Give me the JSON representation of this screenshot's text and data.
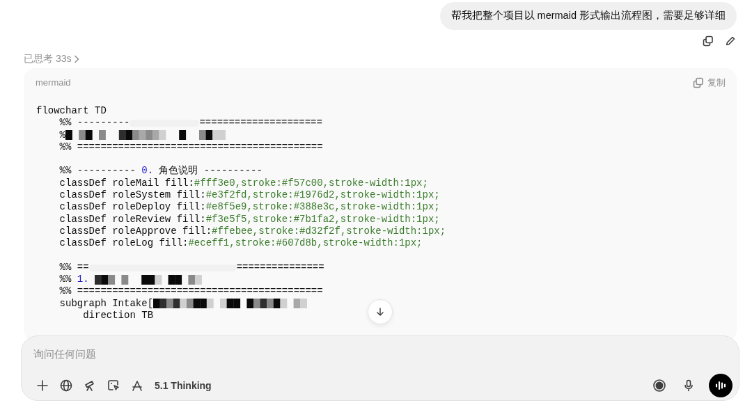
{
  "user_message": {
    "text": "帮我把整个项目以 mermaid 形式输出流程图，需要足够详细"
  },
  "thinking": {
    "label": "已思考 33s"
  },
  "code_block": {
    "language": "mermaid",
    "copy_label": "复制",
    "lines": [
      {
        "segments": [
          {
            "kind": "plain",
            "text": "flowchart TD"
          }
        ]
      },
      {
        "segments": [
          {
            "kind": "plain",
            "text": "    %% ---------"
          },
          {
            "kind": "smear"
          },
          {
            "kind": "plain",
            "text": "====================="
          }
        ]
      },
      {
        "segments": [
          {
            "kind": "plain",
            "text": "    %"
          },
          {
            "kind": "mosaic"
          }
        ]
      },
      {
        "segments": [
          {
            "kind": "plain",
            "text": "    %% =========================================="
          }
        ]
      },
      {
        "blank": true
      },
      {
        "segments": [
          {
            "kind": "plain",
            "text": "    %% ---------- "
          },
          {
            "kind": "number",
            "text": "0."
          },
          {
            "kind": "plain",
            "text": " 角色说明 ----------"
          }
        ]
      },
      {
        "segments": [
          {
            "kind": "plain",
            "text": "    classDef roleMail fill:"
          },
          {
            "kind": "value",
            "text": "#fff3e0,stroke:#f57c00,stroke-width:1px;"
          }
        ]
      },
      {
        "segments": [
          {
            "kind": "plain",
            "text": "    classDef roleSystem fill:"
          },
          {
            "kind": "value",
            "text": "#e3f2fd,stroke:#1976d2,stroke-width:1px;"
          }
        ]
      },
      {
        "segments": [
          {
            "kind": "plain",
            "text": "    classDef roleDeploy fill:"
          },
          {
            "kind": "value",
            "text": "#e8f5e9,stroke:#388e3c,stroke-width:1px;"
          }
        ]
      },
      {
        "segments": [
          {
            "kind": "plain",
            "text": "    classDef roleReview fill:"
          },
          {
            "kind": "value",
            "text": "#f3e5f5,stroke:#7b1fa2,stroke-width:1px;"
          }
        ]
      },
      {
        "segments": [
          {
            "kind": "plain",
            "text": "    classDef roleApprove fill:"
          },
          {
            "kind": "value",
            "text": "#ffebee,stroke:#d32f2f,stroke-width:1px;"
          }
        ]
      },
      {
        "segments": [
          {
            "kind": "plain",
            "text": "    classDef roleLog fill:"
          },
          {
            "kind": "value",
            "text": "#eceff1,stroke:#607d8b,stroke-width:1px;"
          }
        ]
      },
      {
        "blank": true
      },
      {
        "segments": [
          {
            "kind": "plain",
            "text": "    %% =="
          },
          {
            "kind": "smear"
          },
          {
            "kind": "plain",
            "text": "==============="
          }
        ]
      },
      {
        "segments": [
          {
            "kind": "plain",
            "text": "    %% "
          },
          {
            "kind": "number",
            "text": "1."
          },
          {
            "kind": "mosaic"
          }
        ]
      },
      {
        "segments": [
          {
            "kind": "plain",
            "text": "    %% =========================================="
          }
        ]
      },
      {
        "segments": [
          {
            "kind": "plain",
            "text": "    subgraph Intake["
          },
          {
            "kind": "mosaic"
          }
        ]
      },
      {
        "segments": [
          {
            "kind": "plain",
            "text": "        direction TB"
          }
        ]
      }
    ]
  },
  "composer": {
    "placeholder": "询问任何问题",
    "model": "5.1 Thinking"
  }
}
